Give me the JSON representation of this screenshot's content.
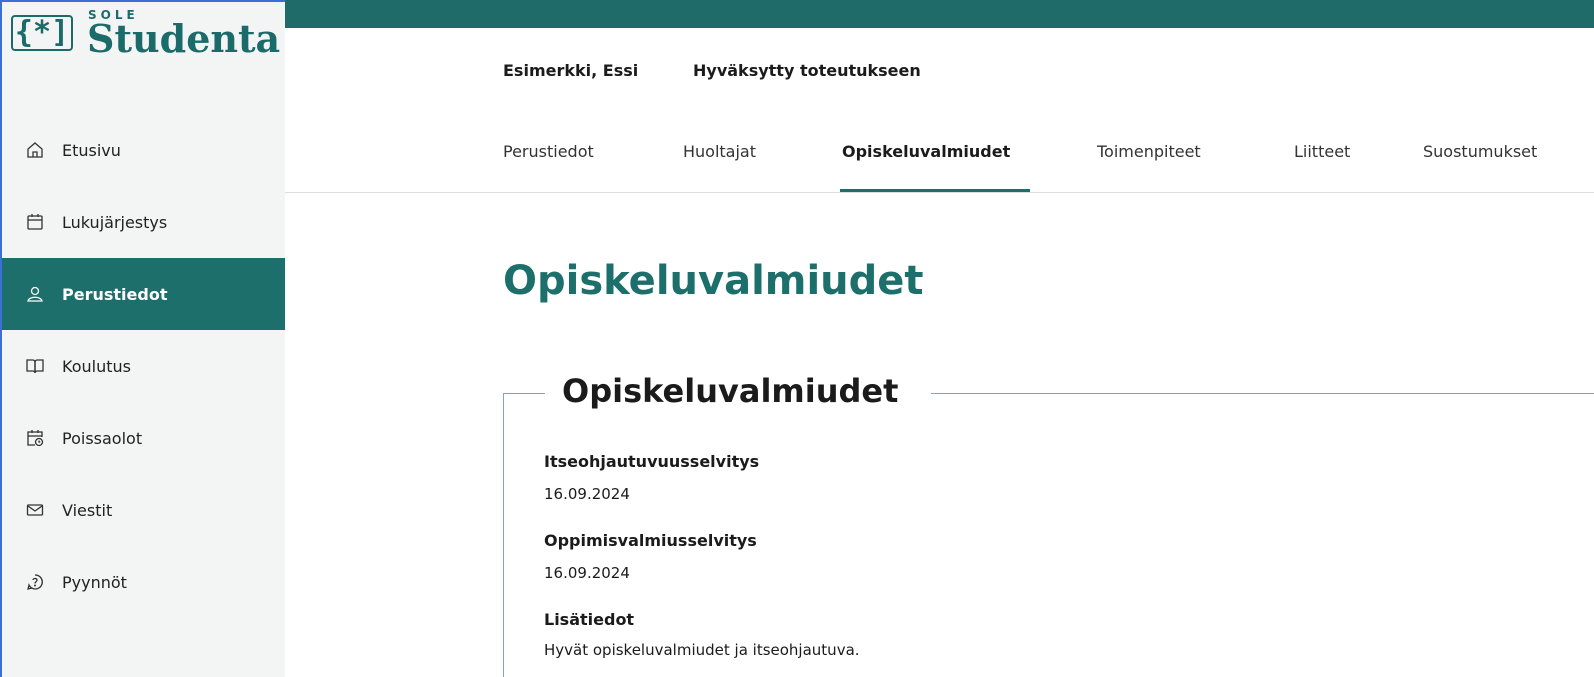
{
  "logo": {
    "superscript": "SOLE",
    "name": "Studenta",
    "mark": "{*]"
  },
  "sidebar": {
    "items": [
      {
        "label": "Etusivu",
        "icon": "home-icon"
      },
      {
        "label": "Lukujärjestys",
        "icon": "calendar-icon"
      },
      {
        "label": "Perustiedot",
        "icon": "user-icon",
        "active": true
      },
      {
        "label": "Koulutus",
        "icon": "book-icon"
      },
      {
        "label": "Poissaolot",
        "icon": "calendar-clock-icon"
      },
      {
        "label": "Viestit",
        "icon": "mail-icon"
      },
      {
        "label": "Pyynnöt",
        "icon": "help-icon"
      }
    ]
  },
  "header": {
    "student_name": "Esimerkki, Essi",
    "student_status": "Hyväksytty toteutukseen"
  },
  "tabs": [
    {
      "label": "Perustiedot"
    },
    {
      "label": "Huoltajat"
    },
    {
      "label": "Opiskeluvalmiudet",
      "active": true
    },
    {
      "label": "Toimenpiteet"
    },
    {
      "label": "Liitteet"
    },
    {
      "label": "Suostumukset"
    }
  ],
  "main": {
    "title": "Opiskeluvalmiudet",
    "section": {
      "legend": "Opiskeluvalmiudet",
      "fields": [
        {
          "label": "Itseohjautuvuusselvitys",
          "value": "16.09.2024"
        },
        {
          "label": "Oppimisvalmiusselvitys",
          "value": "16.09.2024"
        },
        {
          "label": "Lisätiedot",
          "value": "Hyvät opiskeluvalmiudet ja itseohjautuva."
        }
      ]
    }
  },
  "colors": {
    "brand": "#1d6f6c",
    "topbar": "#1e6b6a",
    "sidebar_bg": "#f3f4f4"
  }
}
